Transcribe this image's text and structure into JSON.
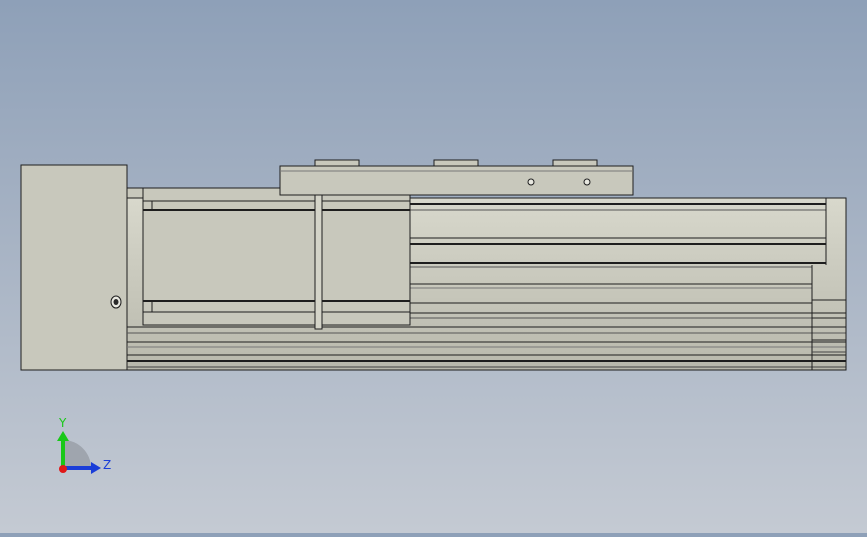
{
  "viewport": {
    "view_orientation": "side view",
    "background": {
      "top_color": "#8ea0b8",
      "bottom_color": "#c4cad3"
    },
    "part_colors": {
      "body": "#c8c8bc",
      "edge": "#1e1e1e",
      "shadow": "#8e8e84"
    }
  },
  "triad": {
    "y_label": "Y",
    "z_label": "Z",
    "colors": {
      "y_axis": "#18c818",
      "z_axis": "#1a3ed8",
      "x_axis": "#e01818"
    }
  }
}
